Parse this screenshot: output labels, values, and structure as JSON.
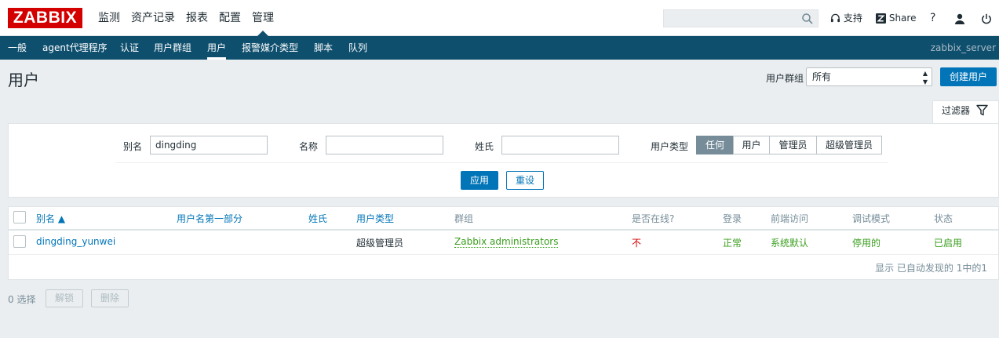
{
  "brand": {
    "logo": "ZABBIX",
    "color": "#d40000"
  },
  "main_menu": [
    {
      "label": "监测"
    },
    {
      "label": "资产记录"
    },
    {
      "label": "报表"
    },
    {
      "label": "配置"
    },
    {
      "label": "管理",
      "active": true
    }
  ],
  "top_right": {
    "support": "支持",
    "share": "Share",
    "help": "?"
  },
  "sub_menu": [
    {
      "label": "一般"
    },
    {
      "label": "agent代理程序"
    },
    {
      "label": "认证"
    },
    {
      "label": "用户群组"
    },
    {
      "label": "用户",
      "active": true
    },
    {
      "label": "报警媒介类型"
    },
    {
      "label": "脚本"
    },
    {
      "label": "队列"
    }
  ],
  "server_name": "zabbix_server",
  "page": {
    "title": "用户",
    "group_label": "用户群组",
    "group_value": "所有",
    "create_button": "创建用户"
  },
  "filter": {
    "tab_label": "过滤器",
    "alias_label": "别名",
    "alias_value": "dingding",
    "name_label": "名称",
    "name_value": "",
    "surname_label": "姓氏",
    "surname_value": "",
    "type_label": "用户类型",
    "type_options": [
      "任何",
      "用户",
      "管理员",
      "超级管理员"
    ],
    "type_selected": "任何",
    "apply": "应用",
    "reset": "重设"
  },
  "table": {
    "headers": {
      "alias": "别名 ▲",
      "name": "用户名第一部分",
      "surname": "姓氏",
      "type": "用户类型",
      "groups": "群组",
      "online": "是否在线?",
      "login": "登录",
      "frontend": "前端访问",
      "debug": "调试模式",
      "status": "状态"
    },
    "rows": [
      {
        "alias": "dingding_yunwei",
        "name": "",
        "surname": "",
        "type": "超级管理员",
        "groups": "Zabbix administrators",
        "online": "不",
        "login": "正常",
        "frontend": "系统默认",
        "debug": "停用的",
        "status": "已启用"
      }
    ],
    "footer": "显示 已自动发现的 1中的1"
  },
  "mass_actions": {
    "selected": "0 选择",
    "unblock": "解锁",
    "delete": "删除"
  },
  "colors": {
    "nav": "#0e4f6e",
    "accent": "#0275b8",
    "ok": "#3a9e1e",
    "bad": "#d40000"
  }
}
